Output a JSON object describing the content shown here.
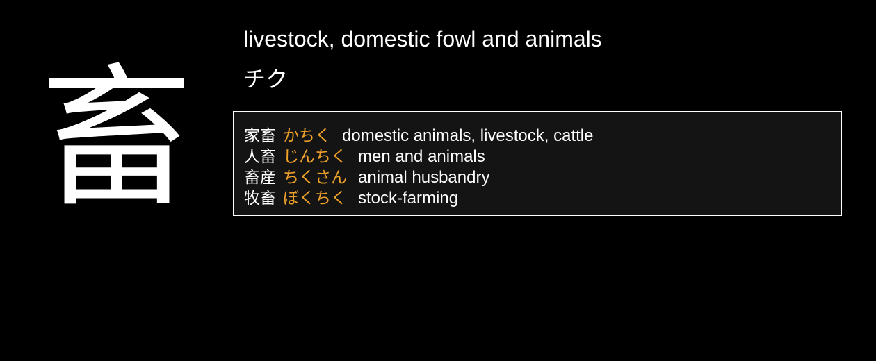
{
  "kanji": {
    "character": "畜",
    "meaning": "livestock, domestic fowl and animals",
    "reading": "チク"
  },
  "vocabulary": [
    {
      "word": "家畜",
      "kana": "かちく",
      "gloss": "domestic animals, livestock, cattle"
    },
    {
      "word": "人畜",
      "kana": "じんちく",
      "gloss": "men and animals"
    },
    {
      "word": "畜産",
      "kana": "ちくさん",
      "gloss": "animal husbandry"
    },
    {
      "word": "牧畜",
      "kana": "ぼくちく",
      "gloss": "stock-farming"
    }
  ],
  "colors": {
    "background": "#000000",
    "text": "#ffffff",
    "kana_accent": "#f0a12a",
    "box_background": "#141414",
    "box_border": "#ffffff"
  }
}
